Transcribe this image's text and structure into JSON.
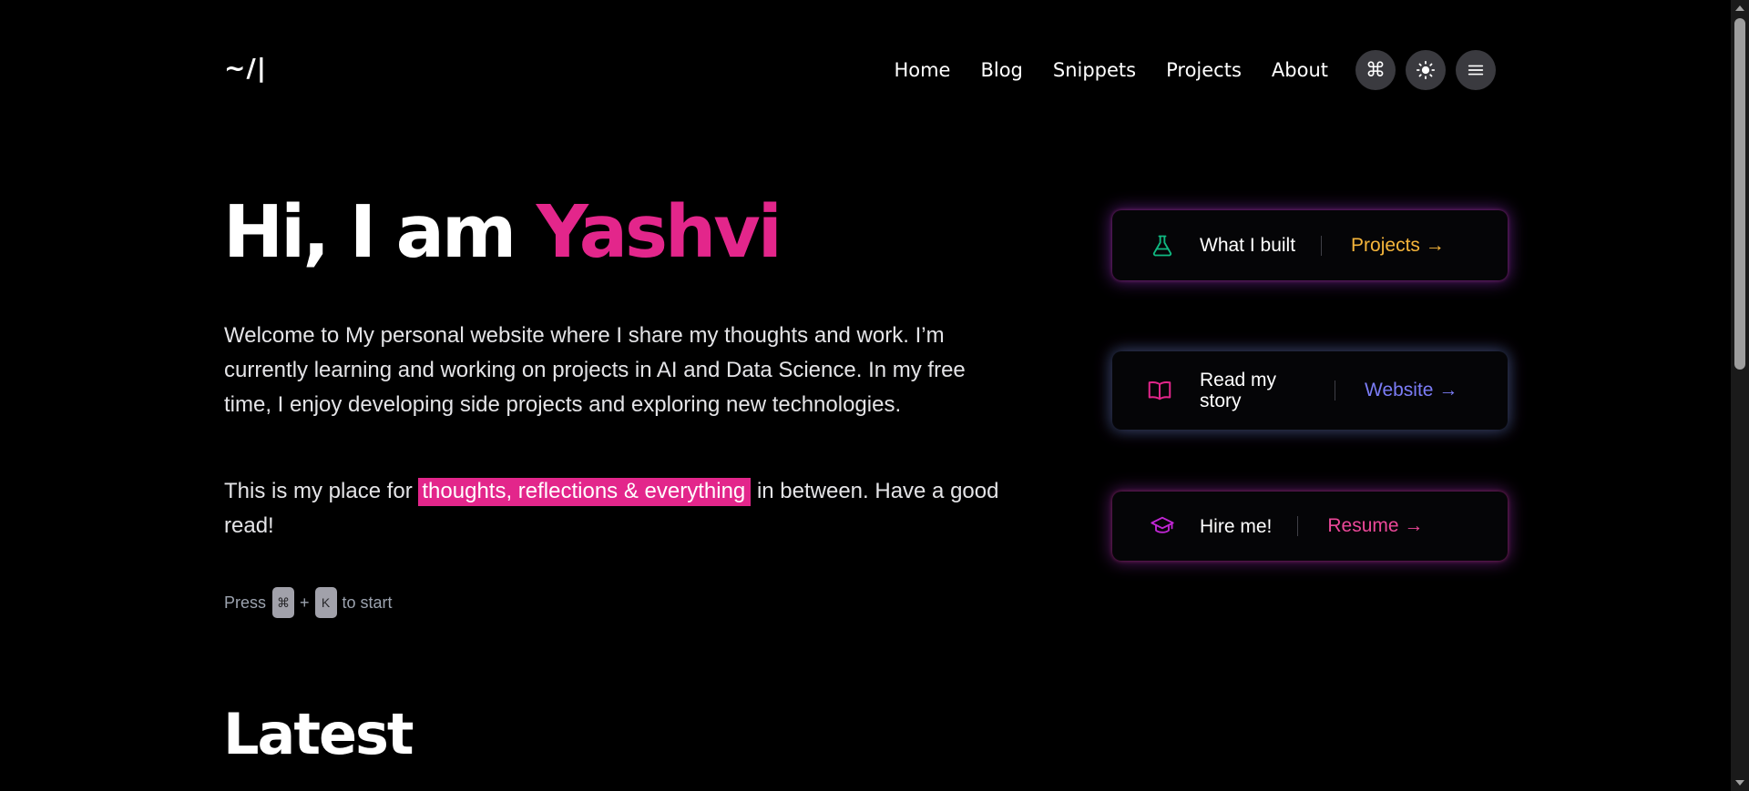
{
  "header": {
    "logo": "~/|",
    "nav": [
      "Home",
      "Blog",
      "Snippets",
      "Projects",
      "About"
    ],
    "buttons": {
      "command": {
        "icon": "command-icon",
        "glyph": "⌘"
      },
      "theme": {
        "icon": "sun-icon",
        "glyph": "☀"
      },
      "menu": {
        "icon": "menu-icon",
        "glyph": "☰"
      }
    }
  },
  "hero": {
    "greeting": "Hi, I am",
    "name": "Yashvi",
    "intro": "Welcome to My personal website where I share my thoughts and work. I’m currently learning and working on projects in AI and Data Science. In my free time, I enjoy developing side projects and exploring new technologies.",
    "place_before": "This is my place for",
    "place_highlight": "thoughts, reflections & everything",
    "place_after": "in between. Have a good read!",
    "press_label": "Press",
    "key1": "⌘",
    "plus": "+",
    "key2": "K",
    "press_suffix": "to start",
    "name_color": "#e3268b"
  },
  "cards": [
    {
      "icon": "flask-icon",
      "text": "What I built",
      "link": "Projects →",
      "link_color": "#f5b53b",
      "icon_color": "#10b981"
    },
    {
      "icon": "book-icon",
      "text": "Read my story",
      "link": "Website →",
      "link_color": "#7b7cf5",
      "icon_color": "#e3268b"
    },
    {
      "icon": "graduation-cap-icon",
      "text": "Hire me!",
      "link": "Resume →",
      "link_color": "#ec4899",
      "icon_color": "#c026d3"
    }
  ],
  "latest": {
    "heading": "Latest"
  }
}
